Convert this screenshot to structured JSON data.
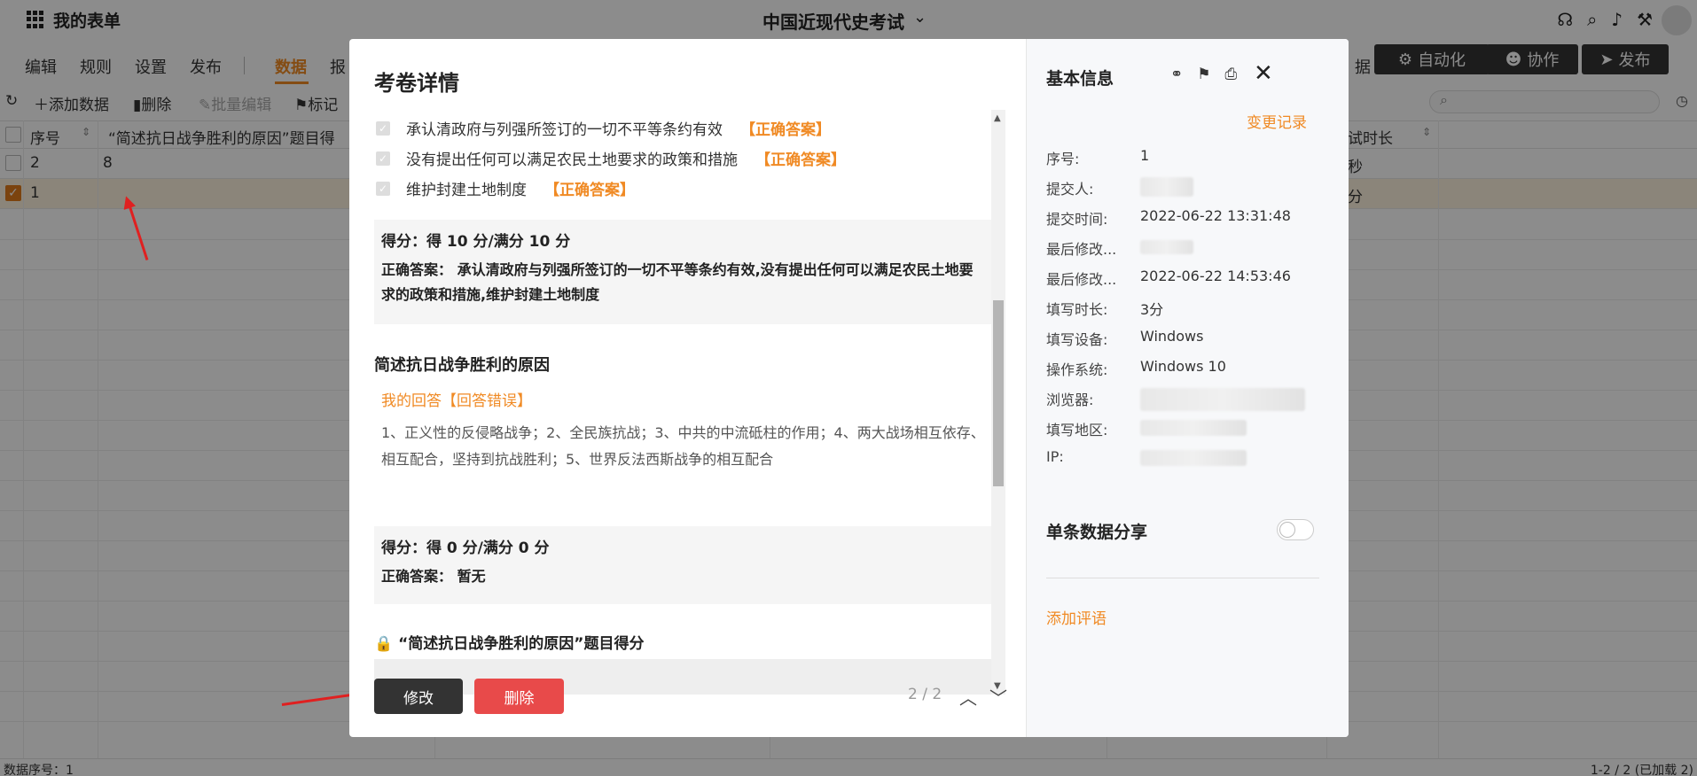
{
  "app": {
    "title": "我的表单",
    "form_title": "中国近现代史考试"
  },
  "menu": {
    "edit": "编辑",
    "rules": "规则",
    "settings": "设置",
    "publish": "发布",
    "data": "数据",
    "report": "报",
    "report_tail": "据"
  },
  "top_buttons": {
    "automation": "自动化",
    "collaborate": "协作",
    "publish": "发布"
  },
  "toolbar": {
    "add_data": "添加数据",
    "delete": "删除",
    "batch_edit": "批量编辑",
    "mark": "标记"
  },
  "table": {
    "headers": {
      "seq": "序号",
      "question_score": "“简述抗日战争胜利的原因”题目得",
      "exam_duration": "试时长"
    },
    "rows": [
      {
        "seq": "2",
        "score": "8",
        "duration": "秒"
      },
      {
        "seq": "1",
        "score": "",
        "duration": "分"
      }
    ]
  },
  "status": {
    "left": "数据序号：1",
    "right": "1-2 / 2 (已加载 2)"
  },
  "modal": {
    "title": "考卷详情",
    "options": [
      {
        "text": "承认清政府与列强所签订的一切不平等条约有效",
        "tag": "【正确答案】"
      },
      {
        "text": "没有提出任何可以满足农民土地要求的政策和措施",
        "tag": "【正确答案】"
      },
      {
        "text": "维护封建土地制度",
        "tag": "【正确答案】"
      }
    ],
    "score1": "得分：得 10 分/满分 10 分",
    "answer1_label": "正确答案：",
    "answer1_text": "承认清政府与列强所签订的一切不平等条约有效,没有提出任何可以满足农民土地要求的政策和措施,维护封建土地制度",
    "q2_title": "简述抗日战争胜利的原因",
    "my_answer": "我的回答【回答错误】",
    "answer2_text": "1、正义性的反侵略战争；2、全民族抗战；3、中共的中流砥柱的作用；4、两大战场相互依存、相互配合，坚持到抗战胜利；5、世界反法西斯战争的相互配合",
    "score2": "得分：得 0 分/满分 0 分",
    "answer2_label": "正确答案：",
    "answer2_correct": "暂无",
    "q3_title": "“简述抗日战争胜利的原因”题目得分",
    "edit_btn": "修改",
    "delete_btn": "删除",
    "pager": "2 / 2"
  },
  "info": {
    "title": "基本信息",
    "change_log": "变更记录",
    "rows": [
      {
        "label": "序号:",
        "value": "1"
      },
      {
        "label": "提交人:",
        "value": ""
      },
      {
        "label": "提交时间:",
        "value": "2022-06-22 13:31:48"
      },
      {
        "label": "最后修改...",
        "value": ""
      },
      {
        "label": "最后修改...",
        "value": "2022-06-22 14:53:46"
      },
      {
        "label": "填写时长:",
        "value": "3分"
      },
      {
        "label": "填写设备:",
        "value": "Windows"
      },
      {
        "label": "操作系统:",
        "value": "Windows 10"
      },
      {
        "label": "浏览器:",
        "value": ""
      },
      {
        "label": "填写地区:",
        "value": ""
      },
      {
        "label": "IP:",
        "value": ""
      }
    ],
    "share_label": "单条数据分享",
    "add_comment": "添加评语"
  },
  "colors": {
    "accent": "#f08a24",
    "danger": "#e84a4a",
    "dark": "#333333"
  }
}
